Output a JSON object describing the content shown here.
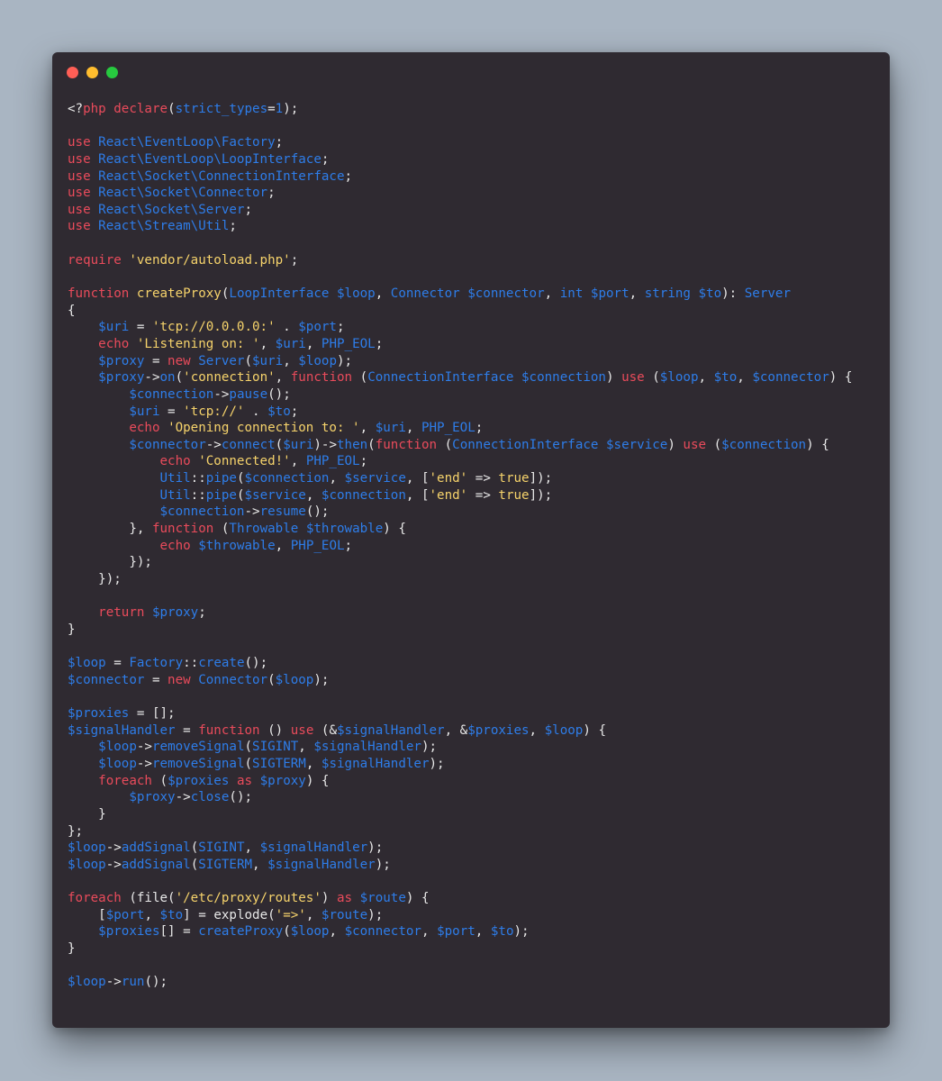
{
  "window": {
    "controls": [
      {
        "name": "close",
        "color": "#ff5f56"
      },
      {
        "name": "minimize",
        "color": "#ffbd2e"
      },
      {
        "name": "maximize",
        "color": "#27c93f"
      }
    ]
  },
  "colors": {
    "background": "#a9b5c2",
    "editor": "#2f2a31",
    "keyword": "#e94b5b",
    "identifier": "#2e7de9",
    "string": "#f6d36b",
    "plain": "#e8e8e8"
  },
  "code": {
    "language": "php",
    "lines": [
      [
        [
          "p",
          "<?"
        ],
        [
          "k",
          "php"
        ],
        [
          "p",
          " "
        ],
        [
          "k",
          "declare"
        ],
        [
          "p",
          "("
        ],
        [
          "v",
          "strict_types"
        ],
        [
          "p",
          "="
        ],
        [
          "v",
          "1"
        ],
        [
          "p",
          ");"
        ]
      ],
      [],
      [
        [
          "k",
          "use"
        ],
        [
          "p",
          " "
        ],
        [
          "v",
          "React\\EventLoop\\Factory"
        ],
        [
          "p",
          ";"
        ]
      ],
      [
        [
          "k",
          "use"
        ],
        [
          "p",
          " "
        ],
        [
          "v",
          "React\\EventLoop\\LoopInterface"
        ],
        [
          "p",
          ";"
        ]
      ],
      [
        [
          "k",
          "use"
        ],
        [
          "p",
          " "
        ],
        [
          "v",
          "React\\Socket\\ConnectionInterface"
        ],
        [
          "p",
          ";"
        ]
      ],
      [
        [
          "k",
          "use"
        ],
        [
          "p",
          " "
        ],
        [
          "v",
          "React\\Socket\\Connector"
        ],
        [
          "p",
          ";"
        ]
      ],
      [
        [
          "k",
          "use"
        ],
        [
          "p",
          " "
        ],
        [
          "v",
          "React\\Socket\\Server"
        ],
        [
          "p",
          ";"
        ]
      ],
      [
        [
          "k",
          "use"
        ],
        [
          "p",
          " "
        ],
        [
          "v",
          "React\\Stream\\Util"
        ],
        [
          "p",
          ";"
        ]
      ],
      [],
      [
        [
          "k",
          "require"
        ],
        [
          "p",
          " "
        ],
        [
          "s",
          "'vendor/autoload.php'"
        ],
        [
          "p",
          ";"
        ]
      ],
      [],
      [
        [
          "k",
          "function"
        ],
        [
          "p",
          " "
        ],
        [
          "s",
          "createProxy"
        ],
        [
          "p",
          "("
        ],
        [
          "v",
          "LoopInterface $loop"
        ],
        [
          "p",
          ", "
        ],
        [
          "v",
          "Connector $connector"
        ],
        [
          "p",
          ", "
        ],
        [
          "v",
          "int $port"
        ],
        [
          "p",
          ", "
        ],
        [
          "v",
          "string $to"
        ],
        [
          "p",
          "): "
        ],
        [
          "v",
          "Server"
        ]
      ],
      [
        [
          "p",
          "{"
        ]
      ],
      [
        [
          "p",
          "    "
        ],
        [
          "v",
          "$uri"
        ],
        [
          "p",
          " = "
        ],
        [
          "s",
          "'tcp://0.0.0.0:'"
        ],
        [
          "p",
          " . "
        ],
        [
          "v",
          "$port"
        ],
        [
          "p",
          ";"
        ]
      ],
      [
        [
          "p",
          "    "
        ],
        [
          "k",
          "echo"
        ],
        [
          "p",
          " "
        ],
        [
          "s",
          "'Listening on: '"
        ],
        [
          "p",
          ", "
        ],
        [
          "v",
          "$uri"
        ],
        [
          "p",
          ", "
        ],
        [
          "v",
          "PHP_EOL"
        ],
        [
          "p",
          ";"
        ]
      ],
      [
        [
          "p",
          "    "
        ],
        [
          "v",
          "$proxy"
        ],
        [
          "p",
          " = "
        ],
        [
          "k",
          "new"
        ],
        [
          "p",
          " "
        ],
        [
          "v",
          "Server"
        ],
        [
          "p",
          "("
        ],
        [
          "v",
          "$uri"
        ],
        [
          "p",
          ", "
        ],
        [
          "v",
          "$loop"
        ],
        [
          "p",
          ");"
        ]
      ],
      [
        [
          "p",
          "    "
        ],
        [
          "v",
          "$proxy"
        ],
        [
          "p",
          "->"
        ],
        [
          "v",
          "on"
        ],
        [
          "p",
          "("
        ],
        [
          "s",
          "'connection'"
        ],
        [
          "p",
          ", "
        ],
        [
          "k",
          "function"
        ],
        [
          "p",
          " ("
        ],
        [
          "v",
          "ConnectionInterface $connection"
        ],
        [
          "p",
          ") "
        ],
        [
          "k",
          "use"
        ],
        [
          "p",
          " ("
        ],
        [
          "v",
          "$loop"
        ],
        [
          "p",
          ", "
        ],
        [
          "v",
          "$to"
        ],
        [
          "p",
          ", "
        ],
        [
          "v",
          "$connector"
        ],
        [
          "p",
          ") {"
        ]
      ],
      [
        [
          "p",
          "        "
        ],
        [
          "v",
          "$connection"
        ],
        [
          "p",
          "->"
        ],
        [
          "v",
          "pause"
        ],
        [
          "p",
          "();"
        ]
      ],
      [
        [
          "p",
          "        "
        ],
        [
          "v",
          "$uri"
        ],
        [
          "p",
          " = "
        ],
        [
          "s",
          "'tcp://'"
        ],
        [
          "p",
          " . "
        ],
        [
          "v",
          "$to"
        ],
        [
          "p",
          ";"
        ]
      ],
      [
        [
          "p",
          "        "
        ],
        [
          "k",
          "echo"
        ],
        [
          "p",
          " "
        ],
        [
          "s",
          "'Opening connection to: '"
        ],
        [
          "p",
          ", "
        ],
        [
          "v",
          "$uri"
        ],
        [
          "p",
          ", "
        ],
        [
          "v",
          "PHP_EOL"
        ],
        [
          "p",
          ";"
        ]
      ],
      [
        [
          "p",
          "        "
        ],
        [
          "v",
          "$connector"
        ],
        [
          "p",
          "->"
        ],
        [
          "v",
          "connect"
        ],
        [
          "p",
          "("
        ],
        [
          "v",
          "$uri"
        ],
        [
          "p",
          ")->"
        ],
        [
          "v",
          "then"
        ],
        [
          "p",
          "("
        ],
        [
          "k",
          "function"
        ],
        [
          "p",
          " ("
        ],
        [
          "v",
          "ConnectionInterface $service"
        ],
        [
          "p",
          ") "
        ],
        [
          "k",
          "use"
        ],
        [
          "p",
          " ("
        ],
        [
          "v",
          "$connection"
        ],
        [
          "p",
          ") {"
        ]
      ],
      [
        [
          "p",
          "            "
        ],
        [
          "k",
          "echo"
        ],
        [
          "p",
          " "
        ],
        [
          "s",
          "'Connected!'"
        ],
        [
          "p",
          ", "
        ],
        [
          "v",
          "PHP_EOL"
        ],
        [
          "p",
          ";"
        ]
      ],
      [
        [
          "p",
          "            "
        ],
        [
          "v",
          "Util"
        ],
        [
          "p",
          "::"
        ],
        [
          "v",
          "pipe"
        ],
        [
          "p",
          "("
        ],
        [
          "v",
          "$connection"
        ],
        [
          "p",
          ", "
        ],
        [
          "v",
          "$service"
        ],
        [
          "p",
          ", ["
        ],
        [
          "s",
          "'end'"
        ],
        [
          "p",
          " => "
        ],
        [
          "s",
          "true"
        ],
        [
          "p",
          "]);"
        ]
      ],
      [
        [
          "p",
          "            "
        ],
        [
          "v",
          "Util"
        ],
        [
          "p",
          "::"
        ],
        [
          "v",
          "pipe"
        ],
        [
          "p",
          "("
        ],
        [
          "v",
          "$service"
        ],
        [
          "p",
          ", "
        ],
        [
          "v",
          "$connection"
        ],
        [
          "p",
          ", ["
        ],
        [
          "s",
          "'end'"
        ],
        [
          "p",
          " => "
        ],
        [
          "s",
          "true"
        ],
        [
          "p",
          "]);"
        ]
      ],
      [
        [
          "p",
          "            "
        ],
        [
          "v",
          "$connection"
        ],
        [
          "p",
          "->"
        ],
        [
          "v",
          "resume"
        ],
        [
          "p",
          "();"
        ]
      ],
      [
        [
          "p",
          "        }, "
        ],
        [
          "k",
          "function"
        ],
        [
          "p",
          " ("
        ],
        [
          "v",
          "Throwable $throwable"
        ],
        [
          "p",
          ") {"
        ]
      ],
      [
        [
          "p",
          "            "
        ],
        [
          "k",
          "echo"
        ],
        [
          "p",
          " "
        ],
        [
          "v",
          "$throwable"
        ],
        [
          "p",
          ", "
        ],
        [
          "v",
          "PHP_EOL"
        ],
        [
          "p",
          ";"
        ]
      ],
      [
        [
          "p",
          "        });"
        ]
      ],
      [
        [
          "p",
          "    });"
        ]
      ],
      [],
      [
        [
          "p",
          "    "
        ],
        [
          "k",
          "return"
        ],
        [
          "p",
          " "
        ],
        [
          "v",
          "$proxy"
        ],
        [
          "p",
          ";"
        ]
      ],
      [
        [
          "p",
          "}"
        ]
      ],
      [],
      [
        [
          "v",
          "$loop"
        ],
        [
          "p",
          " = "
        ],
        [
          "v",
          "Factory"
        ],
        [
          "p",
          "::"
        ],
        [
          "v",
          "create"
        ],
        [
          "p",
          "();"
        ]
      ],
      [
        [
          "v",
          "$connector"
        ],
        [
          "p",
          " = "
        ],
        [
          "k",
          "new"
        ],
        [
          "p",
          " "
        ],
        [
          "v",
          "Connector"
        ],
        [
          "p",
          "("
        ],
        [
          "v",
          "$loop"
        ],
        [
          "p",
          ");"
        ]
      ],
      [],
      [
        [
          "v",
          "$proxies"
        ],
        [
          "p",
          " = [];"
        ]
      ],
      [
        [
          "v",
          "$signalHandler"
        ],
        [
          "p",
          " = "
        ],
        [
          "k",
          "function"
        ],
        [
          "p",
          " () "
        ],
        [
          "k",
          "use"
        ],
        [
          "p",
          " (&"
        ],
        [
          "v",
          "$signalHandler"
        ],
        [
          "p",
          ", &"
        ],
        [
          "v",
          "$proxies"
        ],
        [
          "p",
          ", "
        ],
        [
          "v",
          "$loop"
        ],
        [
          "p",
          ") {"
        ]
      ],
      [
        [
          "p",
          "    "
        ],
        [
          "v",
          "$loop"
        ],
        [
          "p",
          "->"
        ],
        [
          "v",
          "removeSignal"
        ],
        [
          "p",
          "("
        ],
        [
          "v",
          "SIGINT"
        ],
        [
          "p",
          ", "
        ],
        [
          "v",
          "$signalHandler"
        ],
        [
          "p",
          ");"
        ]
      ],
      [
        [
          "p",
          "    "
        ],
        [
          "v",
          "$loop"
        ],
        [
          "p",
          "->"
        ],
        [
          "v",
          "removeSignal"
        ],
        [
          "p",
          "("
        ],
        [
          "v",
          "SIGTERM"
        ],
        [
          "p",
          ", "
        ],
        [
          "v",
          "$signalHandler"
        ],
        [
          "p",
          ");"
        ]
      ],
      [
        [
          "p",
          "    "
        ],
        [
          "k",
          "foreach"
        ],
        [
          "p",
          " ("
        ],
        [
          "v",
          "$proxies"
        ],
        [
          "p",
          " "
        ],
        [
          "k",
          "as"
        ],
        [
          "p",
          " "
        ],
        [
          "v",
          "$proxy"
        ],
        [
          "p",
          ") {"
        ]
      ],
      [
        [
          "p",
          "        "
        ],
        [
          "v",
          "$proxy"
        ],
        [
          "p",
          "->"
        ],
        [
          "v",
          "close"
        ],
        [
          "p",
          "();"
        ]
      ],
      [
        [
          "p",
          "    }"
        ]
      ],
      [
        [
          "p",
          "};"
        ]
      ],
      [
        [
          "v",
          "$loop"
        ],
        [
          "p",
          "->"
        ],
        [
          "v",
          "addSignal"
        ],
        [
          "p",
          "("
        ],
        [
          "v",
          "SIGINT"
        ],
        [
          "p",
          ", "
        ],
        [
          "v",
          "$signalHandler"
        ],
        [
          "p",
          ");"
        ]
      ],
      [
        [
          "v",
          "$loop"
        ],
        [
          "p",
          "->"
        ],
        [
          "v",
          "addSignal"
        ],
        [
          "p",
          "("
        ],
        [
          "v",
          "SIGTERM"
        ],
        [
          "p",
          ", "
        ],
        [
          "v",
          "$signalHandler"
        ],
        [
          "p",
          ");"
        ]
      ],
      [],
      [
        [
          "k",
          "foreach"
        ],
        [
          "p",
          " (file("
        ],
        [
          "s",
          "'/etc/proxy/routes'"
        ],
        [
          "p",
          ") "
        ],
        [
          "k",
          "as"
        ],
        [
          "p",
          " "
        ],
        [
          "v",
          "$route"
        ],
        [
          "p",
          ") {"
        ]
      ],
      [
        [
          "p",
          "    ["
        ],
        [
          "v",
          "$port"
        ],
        [
          "p",
          ", "
        ],
        [
          "v",
          "$to"
        ],
        [
          "p",
          "] = explode("
        ],
        [
          "s",
          "'=>'"
        ],
        [
          "p",
          ", "
        ],
        [
          "v",
          "$route"
        ],
        [
          "p",
          ");"
        ]
      ],
      [
        [
          "p",
          "    "
        ],
        [
          "v",
          "$proxies"
        ],
        [
          "p",
          "[] = "
        ],
        [
          "v",
          "createProxy"
        ],
        [
          "p",
          "("
        ],
        [
          "v",
          "$loop"
        ],
        [
          "p",
          ", "
        ],
        [
          "v",
          "$connector"
        ],
        [
          "p",
          ", "
        ],
        [
          "v",
          "$port"
        ],
        [
          "p",
          ", "
        ],
        [
          "v",
          "$to"
        ],
        [
          "p",
          ");"
        ]
      ],
      [
        [
          "p",
          "}"
        ]
      ],
      [],
      [
        [
          "v",
          "$loop"
        ],
        [
          "p",
          "->"
        ],
        [
          "v",
          "run"
        ],
        [
          "p",
          "();"
        ]
      ]
    ]
  }
}
